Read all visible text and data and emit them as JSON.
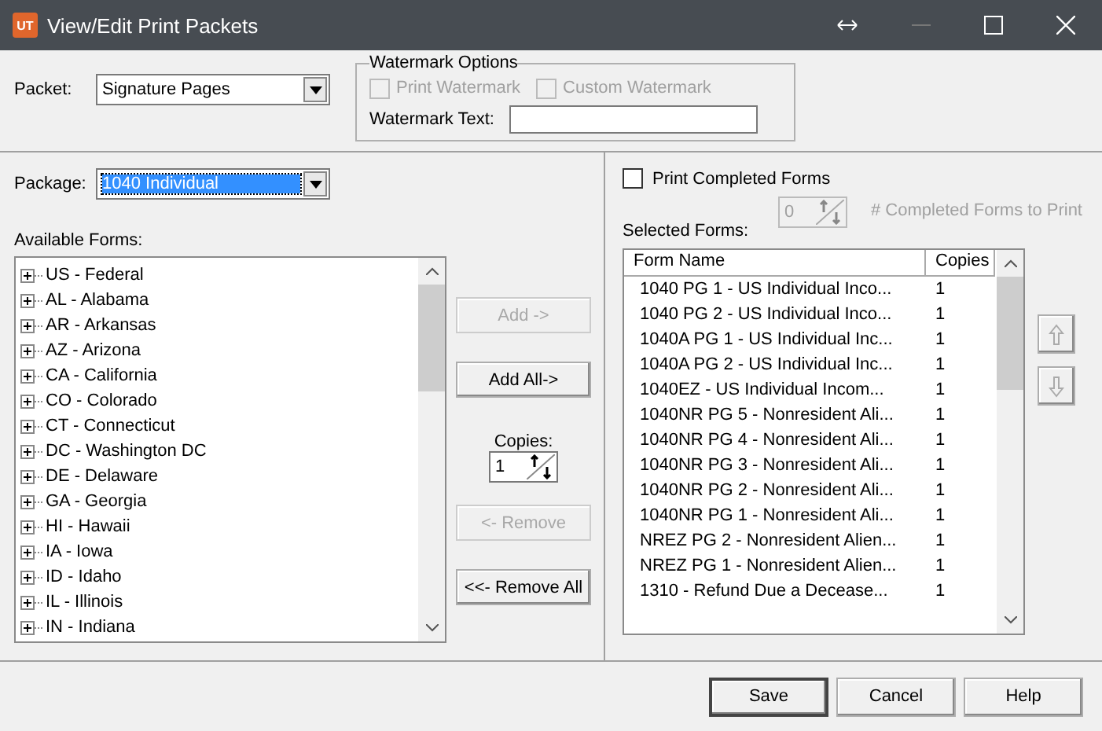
{
  "window": {
    "title": "View/Edit Print Packets",
    "app_badge": "UT"
  },
  "packet": {
    "label": "Packet:",
    "value": "Signature Pages"
  },
  "watermark_options": {
    "title": "Watermark Options",
    "checkboxes": [
      {
        "label": "Print Watermark",
        "checked": false,
        "disabled": true
      },
      {
        "label": "Custom Watermark",
        "checked": false,
        "disabled": true
      }
    ],
    "text_label": "Watermark Text:"
  },
  "package": {
    "label": "Package:",
    "value": "1040 Individual",
    "selected": true
  },
  "available_forms": {
    "label": "Available Forms:",
    "items": [
      {
        "label": "US - Federal",
        "expanded": false
      },
      {
        "label": "AL - Alabama",
        "expanded": false
      },
      {
        "label": "AR - Arkansas",
        "expanded": false
      },
      {
        "label": "AZ - Arizona",
        "expanded": false
      },
      {
        "label": "CA - California",
        "expanded": false
      },
      {
        "label": "CO - Colorado",
        "expanded": false
      },
      {
        "label": "CT - Connecticut",
        "expanded": false
      },
      {
        "label": "DC - Washington DC",
        "expanded": false
      },
      {
        "label": "DE - Delaware",
        "expanded": false
      },
      {
        "label": "GA - Georgia",
        "expanded": false
      },
      {
        "label": "HI - Hawaii",
        "expanded": false
      },
      {
        "label": "IA - Iowa",
        "expanded": false
      },
      {
        "label": "ID - Idaho",
        "expanded": false
      },
      {
        "label": "IL - Illinois",
        "expanded": false
      },
      {
        "label": "IN - Indiana",
        "expanded": false
      }
    ]
  },
  "middle_buttons": [
    {
      "label": "Add ->",
      "disabled": true
    },
    {
      "label": "Add All->",
      "disabled": false
    }
  ],
  "copies": {
    "label": "Copies:",
    "value": "1"
  },
  "remove_buttons": [
    {
      "label": "<- Remove",
      "disabled": true
    },
    {
      "label": "<<- Remove All",
      "disabled": false
    }
  ],
  "print_completed": {
    "label": "Print Completed Forms",
    "checked": false
  },
  "completed_count": {
    "value": "0",
    "label": "# Completed Forms to Print",
    "disabled": true
  },
  "selected_forms": {
    "label": "Selected Forms:",
    "columns": [
      "Form Name",
      "Copies"
    ],
    "rows": [
      [
        "1040 PG 1 - US Individual Inco...",
        "1"
      ],
      [
        "1040 PG 2 - US Individual Inco...",
        "1"
      ],
      [
        "1040A PG 1 - US Individual Inc...",
        "1"
      ],
      [
        "1040A PG 2 - US Individual Inc...",
        "1"
      ],
      [
        "1040EZ  - US Individual Incom...",
        "1"
      ],
      [
        "1040NR PG 5 - Nonresident Ali...",
        "1"
      ],
      [
        "1040NR PG 4 - Nonresident Ali...",
        "1"
      ],
      [
        "1040NR PG 3 - Nonresident Ali...",
        "1"
      ],
      [
        "1040NR PG 2 - Nonresident Ali...",
        "1"
      ],
      [
        "1040NR PG 1 - Nonresident Ali...",
        "1"
      ],
      [
        "NREZ PG 2 - Nonresident Alien...",
        "1"
      ],
      [
        "NREZ PG 1 - Nonresident Alien...",
        "1"
      ],
      [
        "1310 - Refund Due a Decease...",
        "1"
      ]
    ]
  },
  "buttons": [
    {
      "label": "Save",
      "default": true
    },
    {
      "label": "Cancel",
      "default": false
    },
    {
      "label": "Help",
      "default": false
    }
  ]
}
